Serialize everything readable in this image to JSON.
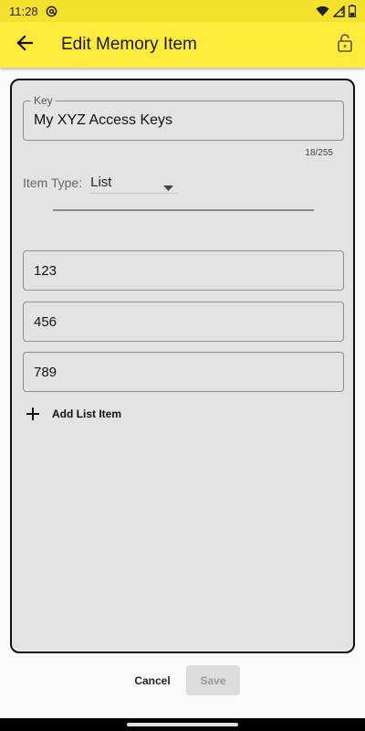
{
  "status_bar": {
    "time": "11:28",
    "icons": [
      "at-sign-icon",
      "wifi-icon",
      "signal-icon",
      "battery-icon"
    ]
  },
  "app_bar": {
    "title": "Edit Memory Item",
    "back_icon": "arrow-left-icon",
    "lock_icon": "lock-open-icon",
    "background": "#ffeb3b"
  },
  "form": {
    "key_label": "Key",
    "key_value": "My XYZ Access Keys",
    "key_counter": "18/255",
    "item_type_label": "Item Type:",
    "item_type_value": "List",
    "list_items": [
      "123",
      "456",
      "789"
    ],
    "add_list_item_label": "Add List Item"
  },
  "actions": {
    "cancel_label": "Cancel",
    "save_label": "Save"
  }
}
